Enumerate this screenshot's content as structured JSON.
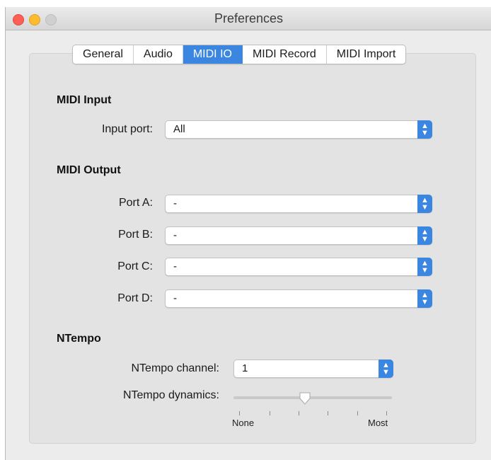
{
  "window": {
    "title": "Preferences"
  },
  "tabs": [
    {
      "label": "General"
    },
    {
      "label": "Audio"
    },
    {
      "label": "MIDI IO"
    },
    {
      "label": "MIDI Record"
    },
    {
      "label": "MIDI Import"
    }
  ],
  "active_tab": "MIDI IO",
  "midi_input": {
    "heading": "MIDI Input",
    "input_port_label": "Input port:",
    "input_port_value": "All"
  },
  "midi_output": {
    "heading": "MIDI Output",
    "ports": [
      {
        "label": "Port A:",
        "value": "-"
      },
      {
        "label": "Port B:",
        "value": "-"
      },
      {
        "label": "Port C:",
        "value": "-"
      },
      {
        "label": "Port D:",
        "value": "-"
      }
    ]
  },
  "ntempo": {
    "heading": "NTempo",
    "channel_label": "NTempo channel:",
    "channel_value": "1",
    "dynamics_label": "NTempo dynamics:",
    "dynamics_min_label": "None",
    "dynamics_max_label": "Most",
    "dynamics_level": 0.45
  },
  "colors": {
    "accent": "#3b86e1",
    "close": "#fc5f57",
    "minimize": "#fdbc2e",
    "zoom_inactive": "#d0d0d0"
  }
}
